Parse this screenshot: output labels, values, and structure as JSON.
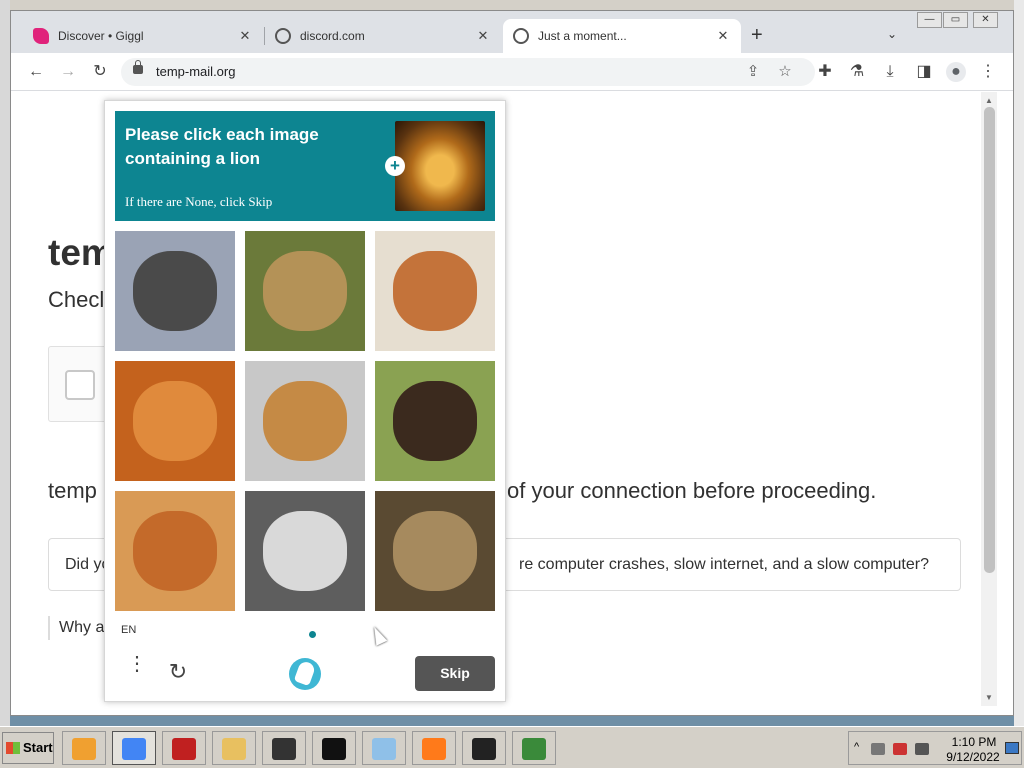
{
  "browser": {
    "tabs": [
      {
        "label": "Discover • Giggl",
        "favicon": "giggl-icon",
        "color": "#e0237b",
        "active": false
      },
      {
        "label": "discord.com",
        "favicon": "globe-icon",
        "color": "#555555",
        "active": false
      },
      {
        "label": "Just a moment...",
        "favicon": "globe-icon",
        "color": "#555555",
        "active": true
      }
    ],
    "tab_close": "✕",
    "new_tab": "+",
    "tab_search": "⌄",
    "window_controls": {
      "minimize": "—",
      "maximize": "▭",
      "close": "✕"
    },
    "toolbar": {
      "back": "←",
      "forward": "→",
      "reload": "↻"
    },
    "url": "temp-mail.org",
    "omnibox_icons": {
      "share": "⇪",
      "bookmark": "☆"
    },
    "toolbar_icons": {
      "extensions": "✚",
      "labs": "⚗",
      "download": "⤓",
      "side_panel": "◨",
      "profile": "●",
      "menu": "⋮"
    }
  },
  "page": {
    "title_fragment": "tem",
    "subtitle_fragment": "Checl",
    "message_left": "temp",
    "message_right": "of your connection before proceeding.",
    "info_left": "Did yo",
    "info_right": "re computer crashes, slow internet, and a slow computer?",
    "why_text": "Why a"
  },
  "captcha": {
    "prompt": "Please click each image containing a lion",
    "hint": "If there are None, click Skip",
    "example_plus": "+",
    "language": "EN",
    "menu_glyph": "⋮",
    "refresh_glyph": "↻",
    "skip_label": "Skip",
    "accent": "#0d8591",
    "tiles": [
      {
        "name": "dark-horse-image",
        "bg": "#9aa3b5",
        "fg": "#4a4a4a"
      },
      {
        "name": "lion-face-image",
        "bg": "#6b7a3a",
        "fg": "#b49257"
      },
      {
        "name": "running-horse-image",
        "bg": "#e6ded0",
        "fg": "#c4733a"
      },
      {
        "name": "orange-cat-image",
        "bg": "#c4621d",
        "fg": "#e08a3c"
      },
      {
        "name": "chihuahua-dog-image",
        "bg": "#c8c8c8",
        "fg": "#c58a45"
      },
      {
        "name": "collie-dog-image",
        "bg": "#8aa252",
        "fg": "#3b2a1e"
      },
      {
        "name": "ginger-cat-image",
        "bg": "#d99a55",
        "fg": "#c46a2a"
      },
      {
        "name": "tabby-cat-image",
        "bg": "#5e5e5e",
        "fg": "#d9d9d9"
      },
      {
        "name": "lion-profile-image",
        "bg": "#5a4a32",
        "fg": "#a68a5e"
      }
    ]
  },
  "taskbar": {
    "start_label": "Start",
    "apps": [
      {
        "name": "media-player-icon",
        "color": "#f0a030",
        "active": false
      },
      {
        "name": "chrome-icon",
        "color": "#4285f4",
        "active": true
      },
      {
        "name": "kart-game-icon",
        "color": "#c02020",
        "active": false
      },
      {
        "name": "file-explorer-icon",
        "color": "#e8c060",
        "active": false
      },
      {
        "name": "inkscape-icon",
        "color": "#333333",
        "active": false
      },
      {
        "name": "command-prompt-icon",
        "color": "#111111",
        "active": false
      },
      {
        "name": "notepad-icon",
        "color": "#8fc0e8",
        "active": false
      },
      {
        "name": "firefox-icon",
        "color": "#ff7a1a",
        "active": false
      },
      {
        "name": "7zip-icon",
        "color": "#222222",
        "active": false
      },
      {
        "name": "network-monitor-icon",
        "color": "#3a8a3a",
        "active": false
      }
    ],
    "tray_arrow": "^",
    "time": "1:10 PM",
    "date": "9/12/2022"
  }
}
